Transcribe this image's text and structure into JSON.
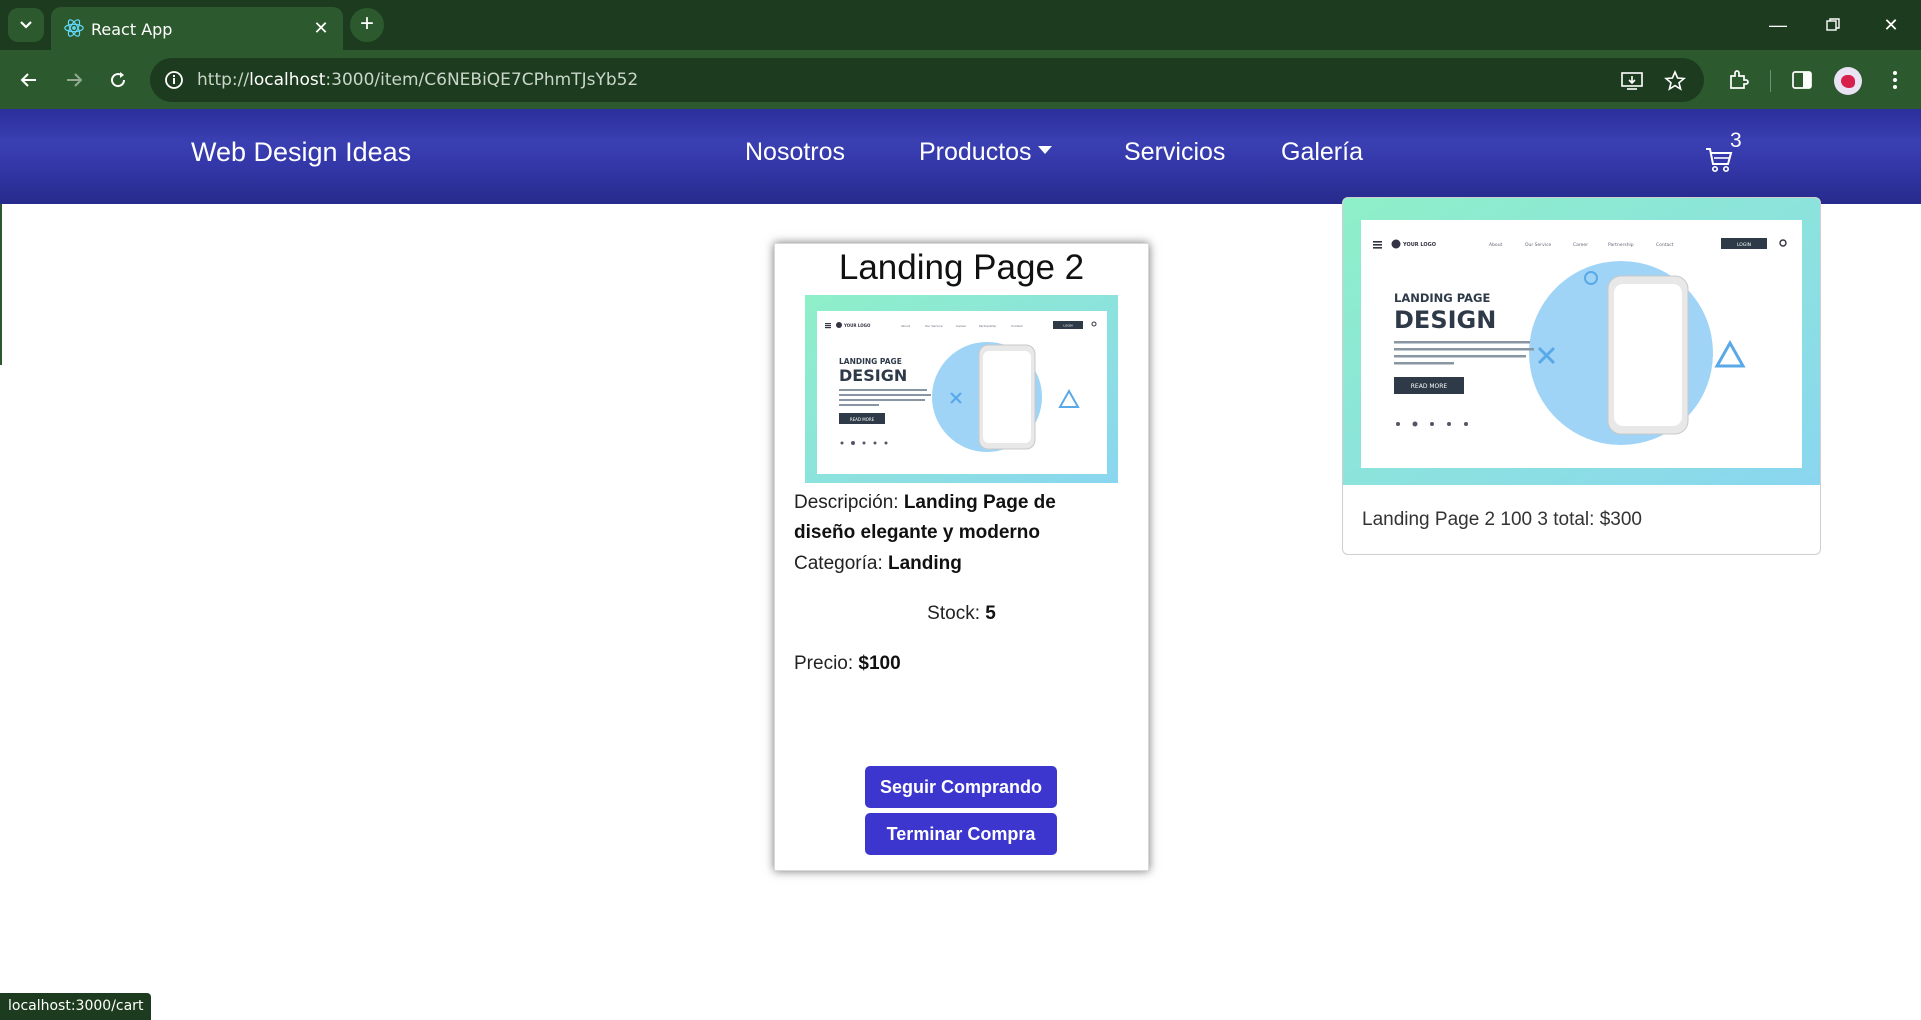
{
  "browser": {
    "tab_title": "React App",
    "url_prefix": "http://",
    "url_host": "localhost",
    "url_rest": ":3000/item/C6NEBiQE7CPhmTJsYb52",
    "status_url": "localhost:3000/cart"
  },
  "navbar": {
    "brand": "Web Design Ideas",
    "links": [
      "Nosotros",
      "Productos",
      "Servicios",
      "Galería"
    ],
    "cart_count": "3"
  },
  "product": {
    "title": "Landing Page 2",
    "image": {
      "heading_small": "LANDING PAGE",
      "heading_big": "DESIGN",
      "logo": "YOUR LOGO",
      "button": "READ MORE",
      "login": "LOGIN",
      "nav": [
        "About",
        "Our Service",
        "Career",
        "Partnership",
        "Contact"
      ]
    },
    "description_label": "Descripción: ",
    "description_line1": "Landing Page de",
    "description_line2": "diseño elegante y moderno",
    "category_label": "Categoría: ",
    "category": "Landing",
    "stock_label": "Stock: ",
    "stock": "5",
    "price_label": "Precio: ",
    "price": "$100",
    "continue_button": "Seguir Comprando",
    "checkout_button": "Terminar Compra"
  },
  "cart_item": {
    "summary": "Landing Page 2 100 3 total: $300"
  },
  "colors": {
    "navbar": "#3337a8",
    "button": "#3c36cf",
    "chrome": "#2c5a2e"
  }
}
